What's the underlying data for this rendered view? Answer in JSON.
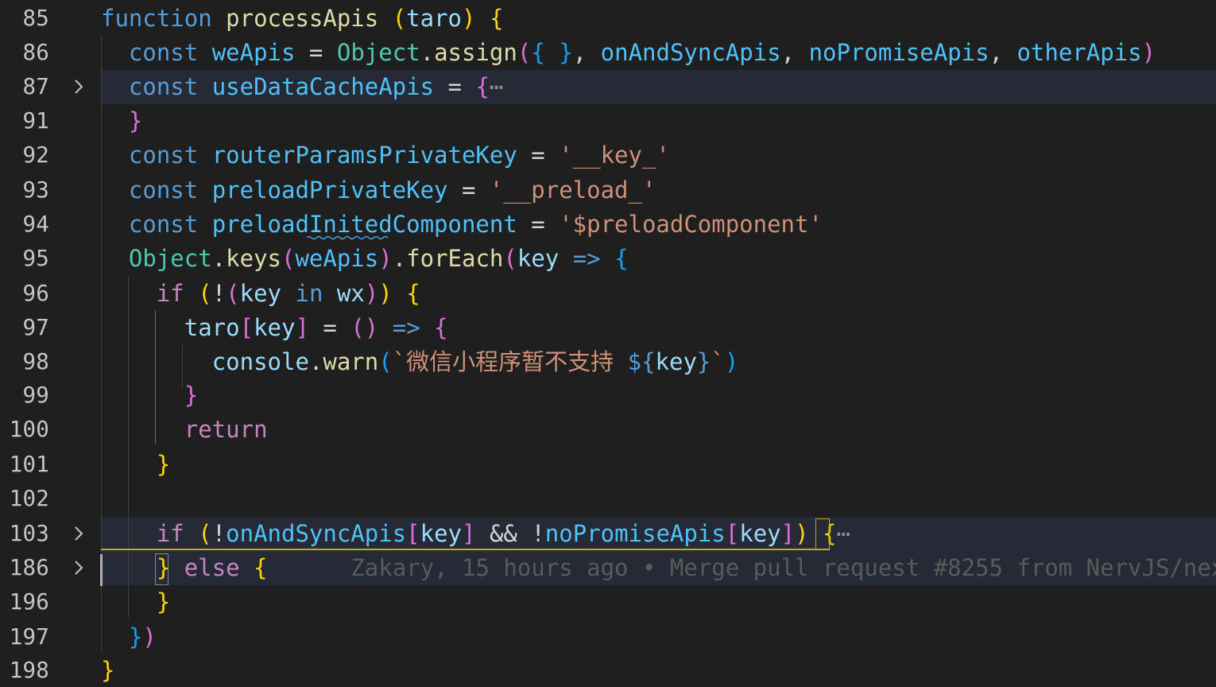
{
  "editor": {
    "lines": [
      {
        "num": "85",
        "tokens": [
          [
            "k-fn",
            "function"
          ],
          [
            "op",
            " "
          ],
          [
            "fname",
            "processApis"
          ],
          [
            "op",
            " "
          ],
          [
            "b1",
            "("
          ],
          [
            "ident",
            "taro"
          ],
          [
            "b1",
            ")"
          ],
          [
            "op",
            " "
          ],
          [
            "b1",
            "{"
          ]
        ]
      },
      {
        "num": "86",
        "tokens": [
          [
            "op",
            "  "
          ],
          [
            "k-const",
            "const"
          ],
          [
            "op",
            " "
          ],
          [
            "cvar",
            "weApis"
          ],
          [
            "op",
            " = "
          ],
          [
            "type",
            "Object"
          ],
          [
            "op",
            "."
          ],
          [
            "fname",
            "assign"
          ],
          [
            "b2",
            "("
          ],
          [
            "b3",
            "{"
          ],
          [
            "op",
            " "
          ],
          [
            "b3",
            "}"
          ],
          [
            "op",
            ", "
          ],
          [
            "cvar",
            "onAndSyncApis"
          ],
          [
            "op",
            ", "
          ],
          [
            "cvar",
            "noPromiseApis"
          ],
          [
            "op",
            ", "
          ],
          [
            "cvar",
            "otherApis"
          ],
          [
            "b2",
            ")"
          ]
        ]
      },
      {
        "num": "87",
        "tokens": [
          [
            "op",
            "  "
          ],
          [
            "k-const",
            "const"
          ],
          [
            "op",
            " "
          ],
          [
            "cvar",
            "useDataCacheApis"
          ],
          [
            "op",
            " = "
          ],
          [
            "b2",
            "{"
          ],
          [
            "ell",
            "⋯"
          ]
        ]
      },
      {
        "num": "91",
        "tokens": [
          [
            "op",
            "  "
          ],
          [
            "b2",
            "}"
          ]
        ]
      },
      {
        "num": "92",
        "tokens": [
          [
            "op",
            "  "
          ],
          [
            "k-const",
            "const"
          ],
          [
            "op",
            " "
          ],
          [
            "cvar",
            "routerParamsPrivateKey"
          ],
          [
            "op",
            " = "
          ],
          [
            "str",
            "'__key_'"
          ]
        ]
      },
      {
        "num": "93",
        "tokens": [
          [
            "op",
            "  "
          ],
          [
            "k-const",
            "const"
          ],
          [
            "op",
            " "
          ],
          [
            "cvar",
            "preloadPrivateKey"
          ],
          [
            "op",
            " = "
          ],
          [
            "str",
            "'__preload_'"
          ]
        ]
      },
      {
        "num": "94",
        "tokens": [
          [
            "op",
            "  "
          ],
          [
            "k-const",
            "const"
          ],
          [
            "op",
            " "
          ],
          [
            "cvar",
            "preloadInitedComponent"
          ],
          [
            "op",
            " = "
          ],
          [
            "str",
            "'$preloadComponent'"
          ]
        ]
      },
      {
        "num": "95",
        "tokens": [
          [
            "op",
            "  "
          ],
          [
            "type",
            "Object"
          ],
          [
            "op",
            "."
          ],
          [
            "fname",
            "keys"
          ],
          [
            "b2",
            "("
          ],
          [
            "cvar",
            "weApis"
          ],
          [
            "b2",
            ")"
          ],
          [
            "op",
            "."
          ],
          [
            "fname",
            "forEach"
          ],
          [
            "b2",
            "("
          ],
          [
            "ident",
            "key"
          ],
          [
            "op",
            " "
          ],
          [
            "k-fn",
            "=>"
          ],
          [
            "op",
            " "
          ],
          [
            "b3",
            "{"
          ]
        ]
      },
      {
        "num": "96",
        "tokens": [
          [
            "op",
            "    "
          ],
          [
            "k-ctrl",
            "if"
          ],
          [
            "op",
            " "
          ],
          [
            "b1",
            "("
          ],
          [
            "op",
            "!"
          ],
          [
            "b2",
            "("
          ],
          [
            "ident",
            "key"
          ],
          [
            "op",
            " "
          ],
          [
            "k-fn",
            "in"
          ],
          [
            "op",
            " "
          ],
          [
            "ident",
            "wx"
          ],
          [
            "b2",
            ")"
          ],
          [
            "b1",
            ")"
          ],
          [
            "op",
            " "
          ],
          [
            "b1",
            "{"
          ]
        ]
      },
      {
        "num": "97",
        "tokens": [
          [
            "op",
            "      "
          ],
          [
            "ident",
            "taro"
          ],
          [
            "b2",
            "["
          ],
          [
            "ident",
            "key"
          ],
          [
            "b2",
            "]"
          ],
          [
            "op",
            " = "
          ],
          [
            "b2",
            "("
          ],
          [
            "b2",
            ")"
          ],
          [
            "op",
            " "
          ],
          [
            "k-fn",
            "=>"
          ],
          [
            "op",
            " "
          ],
          [
            "b2",
            "{"
          ]
        ]
      },
      {
        "num": "98",
        "tokens": [
          [
            "op",
            "        "
          ],
          [
            "ident",
            "console"
          ],
          [
            "op",
            "."
          ],
          [
            "fname",
            "warn"
          ],
          [
            "b3",
            "("
          ],
          [
            "str",
            "`微信小程序暂不支持 "
          ],
          [
            "k-fn",
            "${"
          ],
          [
            "ident",
            "key"
          ],
          [
            "k-fn",
            "}"
          ],
          [
            "str",
            "`"
          ],
          [
            "b3",
            ")"
          ]
        ]
      },
      {
        "num": "99",
        "tokens": [
          [
            "op",
            "      "
          ],
          [
            "b2",
            "}"
          ]
        ]
      },
      {
        "num": "100",
        "tokens": [
          [
            "op",
            "      "
          ],
          [
            "k-ctrl",
            "return"
          ]
        ]
      },
      {
        "num": "101",
        "tokens": [
          [
            "op",
            "    "
          ],
          [
            "b1",
            "}"
          ]
        ]
      },
      {
        "num": "102",
        "tokens": []
      },
      {
        "num": "103",
        "tokens": [
          [
            "op",
            "    "
          ],
          [
            "k-ctrl",
            "if"
          ],
          [
            "op",
            " "
          ],
          [
            "b1",
            "("
          ],
          [
            "op",
            "!"
          ],
          [
            "cvar",
            "onAndSyncApis"
          ],
          [
            "b2",
            "["
          ],
          [
            "ident",
            "key"
          ],
          [
            "b2",
            "]"
          ],
          [
            "op",
            " && !"
          ],
          [
            "cvar",
            "noPromiseApis"
          ],
          [
            "b2",
            "["
          ],
          [
            "ident",
            "key"
          ],
          [
            "b2",
            "]"
          ],
          [
            "b1",
            ")"
          ],
          [
            "op",
            " "
          ],
          [
            "b1",
            "{"
          ],
          [
            "ell",
            "⋯"
          ]
        ]
      },
      {
        "num": "186",
        "tokens": [
          [
            "op",
            "    "
          ],
          [
            "b1",
            "}"
          ],
          [
            "op",
            " "
          ],
          [
            "k-ctrl",
            "else"
          ],
          [
            "op",
            " "
          ],
          [
            "b1",
            "{"
          ]
        ]
      },
      {
        "num": "196",
        "tokens": [
          [
            "op",
            "    "
          ],
          [
            "b1",
            "}"
          ]
        ]
      },
      {
        "num": "197",
        "tokens": [
          [
            "op",
            "  "
          ],
          [
            "b3",
            "}"
          ],
          [
            "b2",
            ")"
          ]
        ]
      },
      {
        "num": "198",
        "tokens": [
          [
            "b1",
            "}"
          ]
        ]
      }
    ],
    "blame": "Zakary, 15 hours ago • Merge pull request #8255 from NervJS/nex",
    "colors": {
      "background": "#1f1f1f",
      "keyword": "#569cd6",
      "control": "#c586c0",
      "function": "#dcdcaa",
      "string": "#ce9178",
      "variable": "#4fc1ff",
      "type": "#4ec9b0"
    }
  }
}
